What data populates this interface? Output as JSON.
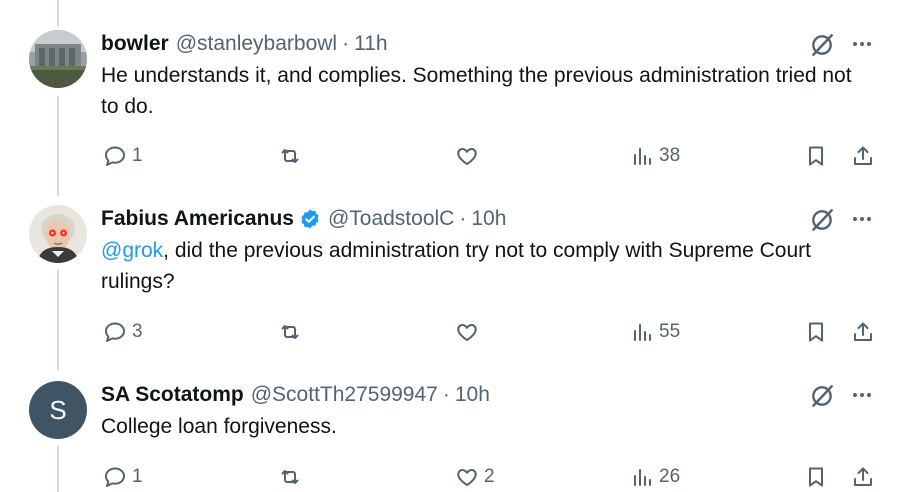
{
  "tweets": [
    {
      "name": "bowler",
      "handle": "@stanleybarbowl",
      "sep": "·",
      "time": "11h",
      "verified": false,
      "avatar_type": "photo-building",
      "text_plain": "He understands it, and complies. Something the previous administration tried not to do.",
      "replies": "1",
      "reposts": "",
      "likes": "",
      "views": "38"
    },
    {
      "name": "Fabius Americanus",
      "handle": "@ToadstoolC",
      "sep": "·",
      "time": "10h",
      "verified": true,
      "avatar_type": "portrait-red-eyes",
      "mention": "@grok",
      "text_rest": ", did the previous administration try not to comply with Supreme Court rulings?",
      "replies": "3",
      "reposts": "",
      "likes": "",
      "views": "55"
    },
    {
      "name": "SA Scotatomp",
      "handle": "@ScottTh27599947",
      "sep": "·",
      "time": "10h",
      "verified": false,
      "avatar_letter": "S",
      "text_plain": "College loan forgiveness.",
      "replies": "1",
      "reposts": "",
      "likes": "2",
      "views": "26"
    }
  ],
  "icons": {
    "reply": "reply-icon",
    "repost": "repost-icon",
    "like": "heart-icon",
    "views": "views-icon",
    "bookmark": "bookmark-icon",
    "share": "share-icon",
    "grok": "grok-icon",
    "more": "more-icon",
    "verified": "verified-badge-icon"
  },
  "colors": {
    "text": "#0f1419",
    "muted": "#536471",
    "link": "#1d9bf0",
    "thread_line": "#cfd9de",
    "verified": "#1d9bf0"
  }
}
